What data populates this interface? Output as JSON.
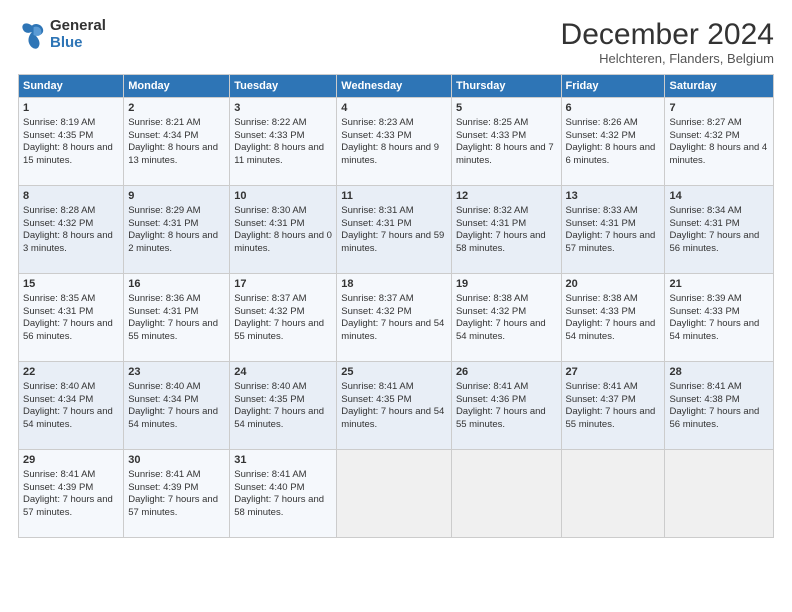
{
  "logo": {
    "line1": "General",
    "line2": "Blue"
  },
  "title": "December 2024",
  "subtitle": "Helchteren, Flanders, Belgium",
  "headers": [
    "Sunday",
    "Monday",
    "Tuesday",
    "Wednesday",
    "Thursday",
    "Friday",
    "Saturday"
  ],
  "weeks": [
    [
      {
        "day": "1",
        "rise": "Sunrise: 8:19 AM",
        "set": "Sunset: 4:35 PM",
        "daylight": "Daylight: 8 hours and 15 minutes."
      },
      {
        "day": "2",
        "rise": "Sunrise: 8:21 AM",
        "set": "Sunset: 4:34 PM",
        "daylight": "Daylight: 8 hours and 13 minutes."
      },
      {
        "day": "3",
        "rise": "Sunrise: 8:22 AM",
        "set": "Sunset: 4:33 PM",
        "daylight": "Daylight: 8 hours and 11 minutes."
      },
      {
        "day": "4",
        "rise": "Sunrise: 8:23 AM",
        "set": "Sunset: 4:33 PM",
        "daylight": "Daylight: 8 hours and 9 minutes."
      },
      {
        "day": "5",
        "rise": "Sunrise: 8:25 AM",
        "set": "Sunset: 4:33 PM",
        "daylight": "Daylight: 8 hours and 7 minutes."
      },
      {
        "day": "6",
        "rise": "Sunrise: 8:26 AM",
        "set": "Sunset: 4:32 PM",
        "daylight": "Daylight: 8 hours and 6 minutes."
      },
      {
        "day": "7",
        "rise": "Sunrise: 8:27 AM",
        "set": "Sunset: 4:32 PM",
        "daylight": "Daylight: 8 hours and 4 minutes."
      }
    ],
    [
      {
        "day": "8",
        "rise": "Sunrise: 8:28 AM",
        "set": "Sunset: 4:32 PM",
        "daylight": "Daylight: 8 hours and 3 minutes."
      },
      {
        "day": "9",
        "rise": "Sunrise: 8:29 AM",
        "set": "Sunset: 4:31 PM",
        "daylight": "Daylight: 8 hours and 2 minutes."
      },
      {
        "day": "10",
        "rise": "Sunrise: 8:30 AM",
        "set": "Sunset: 4:31 PM",
        "daylight": "Daylight: 8 hours and 0 minutes."
      },
      {
        "day": "11",
        "rise": "Sunrise: 8:31 AM",
        "set": "Sunset: 4:31 PM",
        "daylight": "Daylight: 7 hours and 59 minutes."
      },
      {
        "day": "12",
        "rise": "Sunrise: 8:32 AM",
        "set": "Sunset: 4:31 PM",
        "daylight": "Daylight: 7 hours and 58 minutes."
      },
      {
        "day": "13",
        "rise": "Sunrise: 8:33 AM",
        "set": "Sunset: 4:31 PM",
        "daylight": "Daylight: 7 hours and 57 minutes."
      },
      {
        "day": "14",
        "rise": "Sunrise: 8:34 AM",
        "set": "Sunset: 4:31 PM",
        "daylight": "Daylight: 7 hours and 56 minutes."
      }
    ],
    [
      {
        "day": "15",
        "rise": "Sunrise: 8:35 AM",
        "set": "Sunset: 4:31 PM",
        "daylight": "Daylight: 7 hours and 56 minutes."
      },
      {
        "day": "16",
        "rise": "Sunrise: 8:36 AM",
        "set": "Sunset: 4:31 PM",
        "daylight": "Daylight: 7 hours and 55 minutes."
      },
      {
        "day": "17",
        "rise": "Sunrise: 8:37 AM",
        "set": "Sunset: 4:32 PM",
        "daylight": "Daylight: 7 hours and 55 minutes."
      },
      {
        "day": "18",
        "rise": "Sunrise: 8:37 AM",
        "set": "Sunset: 4:32 PM",
        "daylight": "Daylight: 7 hours and 54 minutes."
      },
      {
        "day": "19",
        "rise": "Sunrise: 8:38 AM",
        "set": "Sunset: 4:32 PM",
        "daylight": "Daylight: 7 hours and 54 minutes."
      },
      {
        "day": "20",
        "rise": "Sunrise: 8:38 AM",
        "set": "Sunset: 4:33 PM",
        "daylight": "Daylight: 7 hours and 54 minutes."
      },
      {
        "day": "21",
        "rise": "Sunrise: 8:39 AM",
        "set": "Sunset: 4:33 PM",
        "daylight": "Daylight: 7 hours and 54 minutes."
      }
    ],
    [
      {
        "day": "22",
        "rise": "Sunrise: 8:40 AM",
        "set": "Sunset: 4:34 PM",
        "daylight": "Daylight: 7 hours and 54 minutes."
      },
      {
        "day": "23",
        "rise": "Sunrise: 8:40 AM",
        "set": "Sunset: 4:34 PM",
        "daylight": "Daylight: 7 hours and 54 minutes."
      },
      {
        "day": "24",
        "rise": "Sunrise: 8:40 AM",
        "set": "Sunset: 4:35 PM",
        "daylight": "Daylight: 7 hours and 54 minutes."
      },
      {
        "day": "25",
        "rise": "Sunrise: 8:41 AM",
        "set": "Sunset: 4:35 PM",
        "daylight": "Daylight: 7 hours and 54 minutes."
      },
      {
        "day": "26",
        "rise": "Sunrise: 8:41 AM",
        "set": "Sunset: 4:36 PM",
        "daylight": "Daylight: 7 hours and 55 minutes."
      },
      {
        "day": "27",
        "rise": "Sunrise: 8:41 AM",
        "set": "Sunset: 4:37 PM",
        "daylight": "Daylight: 7 hours and 55 minutes."
      },
      {
        "day": "28",
        "rise": "Sunrise: 8:41 AM",
        "set": "Sunset: 4:38 PM",
        "daylight": "Daylight: 7 hours and 56 minutes."
      }
    ],
    [
      {
        "day": "29",
        "rise": "Sunrise: 8:41 AM",
        "set": "Sunset: 4:39 PM",
        "daylight": "Daylight: 7 hours and 57 minutes."
      },
      {
        "day": "30",
        "rise": "Sunrise: 8:41 AM",
        "set": "Sunset: 4:39 PM",
        "daylight": "Daylight: 7 hours and 57 minutes."
      },
      {
        "day": "31",
        "rise": "Sunrise: 8:41 AM",
        "set": "Sunset: 4:40 PM",
        "daylight": "Daylight: 7 hours and 58 minutes."
      },
      null,
      null,
      null,
      null
    ]
  ]
}
